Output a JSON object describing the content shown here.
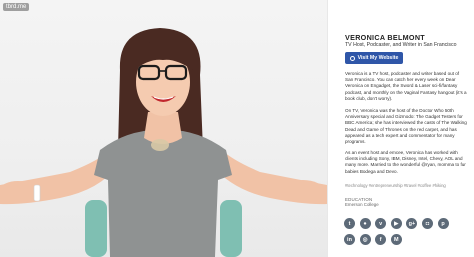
{
  "watermark": "tbrd.me",
  "profile": {
    "name": "VERONICA BELMONT",
    "tagline": "TV Host, Podcaster, and Writer in San Francisco",
    "website_button": "Visit My Website"
  },
  "bio": [
    "Veronica is a TV host, podcaster and writer based out of San Francisco. You can catch her every week on Dear Veronica on Engadget, the Sword & Laser sci-fi/fantasy podcast, and monthly on the Vaginal Fantasy hangout (it's a book club, don't worry).",
    "On TV, Veronica was the host of the Doctor Who 50th Anniversary special and Gizmodo: The Gadget Testers for BBC America; she has interviewed the casts of The Walking Dead and Game of Thrones on the red carpet, and has appeared as a tech expert and commentator for many programs.",
    "As an event host and emcee, Veronica has worked with clients including Sony, IBM, Disney, Intel, Chevy, AOL and many more. Married to the wonderful @ryan, momma to fur babies Bodega and Devo."
  ],
  "tags": "#technology #entrepreneurship #travel #coffee #hiking",
  "education": {
    "label": "EDUCATION",
    "value": "Emerson College"
  },
  "social_row1": [
    {
      "name": "twitter-icon",
      "glyph": "t"
    },
    {
      "name": "flickr-icon",
      "glyph": "●"
    },
    {
      "name": "vimeo-icon",
      "glyph": "v"
    },
    {
      "name": "youtube-icon",
      "glyph": "▶"
    },
    {
      "name": "google-plus-icon",
      "glyph": "g+"
    },
    {
      "name": "instagram-icon",
      "glyph": "◘"
    },
    {
      "name": "pinterest-icon",
      "glyph": "p"
    }
  ],
  "social_row2": [
    {
      "name": "linkedin-icon",
      "glyph": "in"
    },
    {
      "name": "dribbble-icon",
      "glyph": "◎"
    },
    {
      "name": "facebook-icon",
      "glyph": "f"
    },
    {
      "name": "medium-icon",
      "glyph": "M"
    }
  ],
  "colors": {
    "button_blue": "#2f56a8",
    "icon_gray": "#5d6a78",
    "name_text": "#222222"
  }
}
